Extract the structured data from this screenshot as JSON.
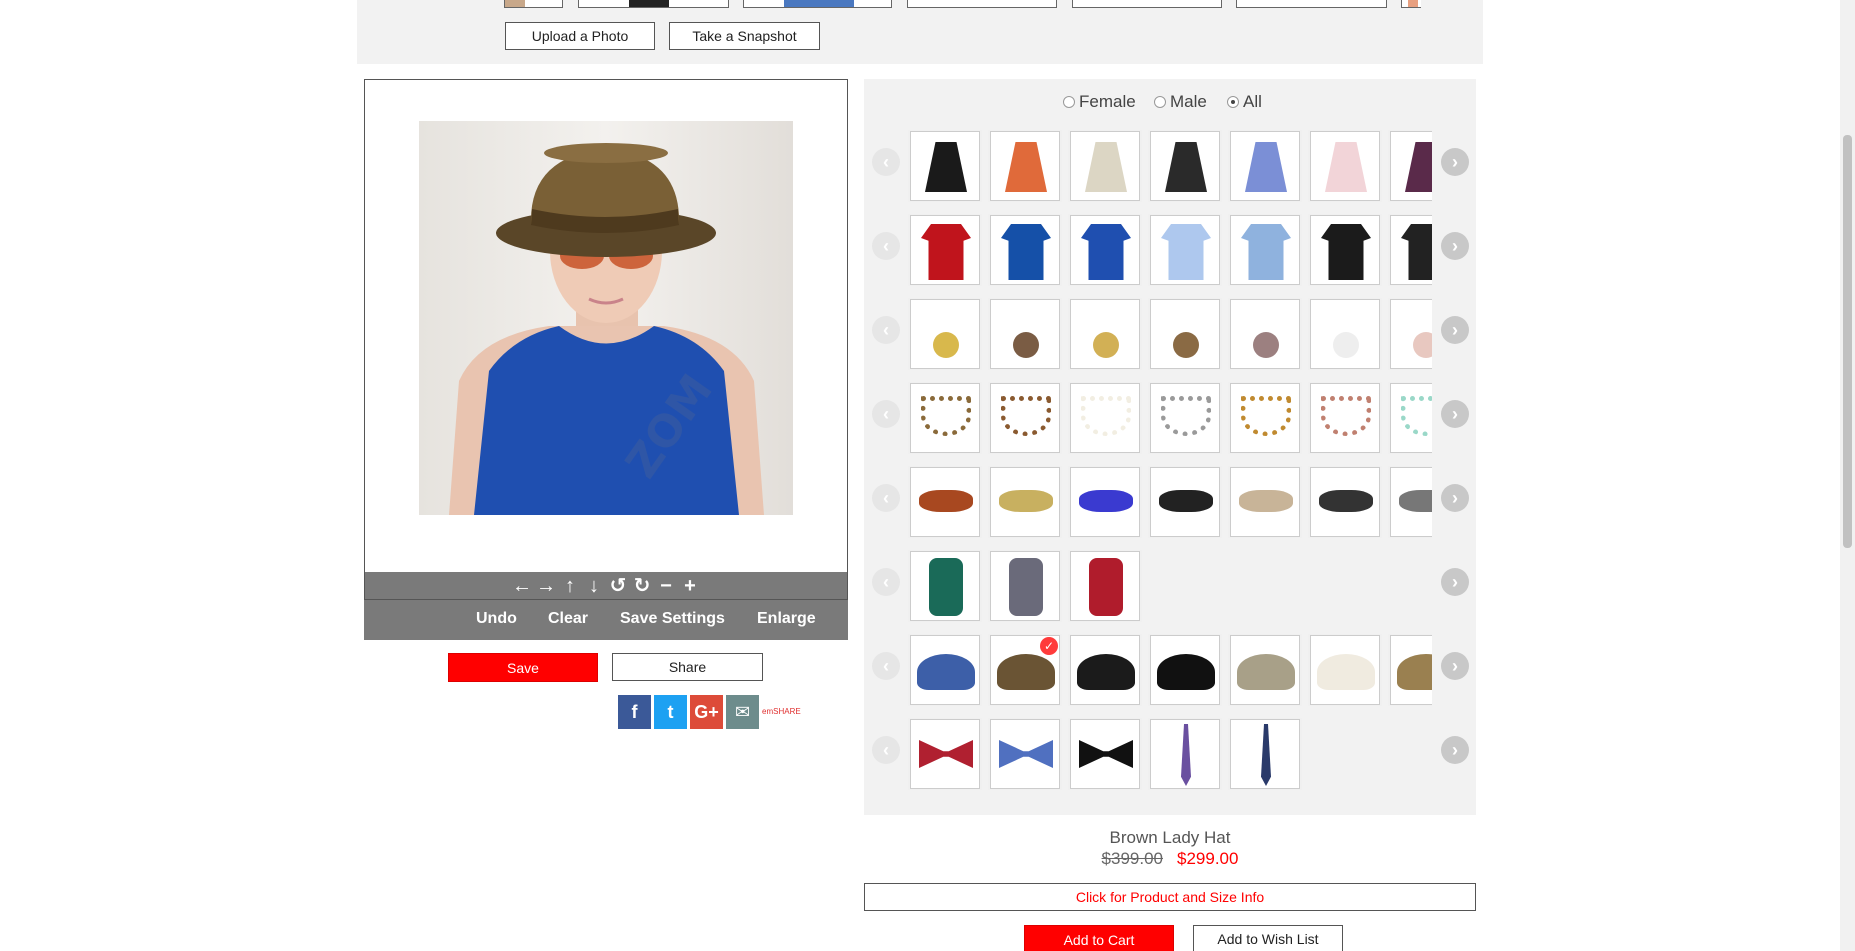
{
  "top": {
    "upload_label": "Upload a Photo",
    "snapshot_label": "Take a Snapshot"
  },
  "editor": {
    "arrows": [
      "←",
      "→",
      "↑",
      "↓",
      "↺",
      "↻",
      "−",
      "+"
    ],
    "undo_label": "Undo",
    "clear_label": "Clear",
    "save_settings_label": "Save Settings",
    "enlarge_label": "Enlarge",
    "save_label": "Save",
    "share_label": "Share",
    "emshare_label": "emSHARE"
  },
  "social": [
    {
      "name": "facebook-icon",
      "glyph": "f",
      "color": "#3b5998"
    },
    {
      "name": "twitter-icon",
      "glyph": "t",
      "color": "#1da1f2"
    },
    {
      "name": "google-plus-icon",
      "glyph": "G+",
      "color": "#dd4b39"
    },
    {
      "name": "email-icon",
      "glyph": "✉",
      "color": "#6d8c8c"
    }
  ],
  "filters": {
    "female": "Female",
    "male": "Male",
    "all": "All",
    "selected": "All"
  },
  "catalog_rows": [
    {
      "category": "skirts",
      "items": [
        "black skirt",
        "orange floral skirt",
        "beige lace skirt",
        "black pleated skirt",
        "plaid multicolor skirt",
        "pink floral skirt",
        "dark floral skirt"
      ],
      "colors": [
        "#1a1a1a",
        "#e06a3a",
        "#dcd6c4",
        "#2a2a2a",
        "#7b8fd6",
        "#f2d4d8",
        "#5a2a4a"
      ]
    },
    {
      "category": "tops",
      "items": [
        "red t-shirt",
        "blue sweatshirt",
        "blue sleeveless top",
        "light blue shirt",
        "blue denim shirt",
        "black suit jacket",
        "dark suit jacket"
      ],
      "colors": [
        "#c0141c",
        "#1550a8",
        "#1f4fb0",
        "#aec8ee",
        "#8fb2de",
        "#1b1b1b",
        "#222"
      ]
    },
    {
      "category": "earrings",
      "items": [
        "gold pearl earring",
        "bronze pearl earring",
        "gold pearl earring",
        "brown pearl earring",
        "mauve pearl earring",
        "white pearl earring",
        "pink pearl earring"
      ],
      "colors": [
        "#d8b84c",
        "#7a5c44",
        "#d2b055",
        "#8a6a44",
        "#9c8080",
        "#eeeeee",
        "#e8c8c0"
      ]
    },
    {
      "category": "necklaces",
      "items": [
        "bronze bead necklace",
        "brown pearl necklace",
        "white pearl necklace",
        "crystal necklace",
        "gold floral necklace",
        "rose stone necklace",
        "mint stone necklace"
      ],
      "colors": [
        "#8a6a3a",
        "#8a5a30",
        "#f2eee2",
        "#9a9a9a",
        "#c08a30",
        "#c08070",
        "#9ad8c8"
      ]
    },
    {
      "category": "sunglasses",
      "items": [
        "tortoise sunglasses",
        "gold aviators",
        "blue lens sunglasses",
        "black cat-eye sunglasses",
        "cream cat-eye sunglasses",
        "black gradient sunglasses",
        "round sunglasses"
      ],
      "colors": [
        "#a84820",
        "#c8b060",
        "#3a3ad0",
        "#222",
        "#c8b498",
        "#333",
        "#777"
      ]
    },
    {
      "category": "scarves",
      "items": [
        "green plaid scarf",
        "gray plaid scarf",
        "red plaid scarf"
      ],
      "colors": [
        "#1a6a58",
        "#6a6a7a",
        "#b01c2c"
      ]
    },
    {
      "category": "hats",
      "items": [
        "blue cap",
        "brown pork pie hat",
        "black captain hat",
        "black wide brim hat",
        "olive sun hat",
        "white panama hat",
        "straw fedora"
      ],
      "colors": [
        "#3d5fa8",
        "#6a5434",
        "#1b1b1b",
        "#111",
        "#a8a088",
        "#f0ebe0",
        "#9a8050"
      ],
      "selected_index": 1
    },
    {
      "category": "ties",
      "items": [
        "flag bow tie",
        "checked bow tie",
        "black bow tie",
        "purple tie",
        "navy tie"
      ],
      "colors": [
        "#b02030",
        "#5070c0",
        "#111",
        "#6a50a0",
        "#2a3a6a"
      ]
    }
  ],
  "product": {
    "title": "Brown Lady Hat",
    "old_price": "$399.00",
    "new_price": "$299.00",
    "info_label": "Click for Product and Size Info",
    "add_to_cart_label": "Add to Cart",
    "wishlist_label": "Add to Wish List"
  }
}
